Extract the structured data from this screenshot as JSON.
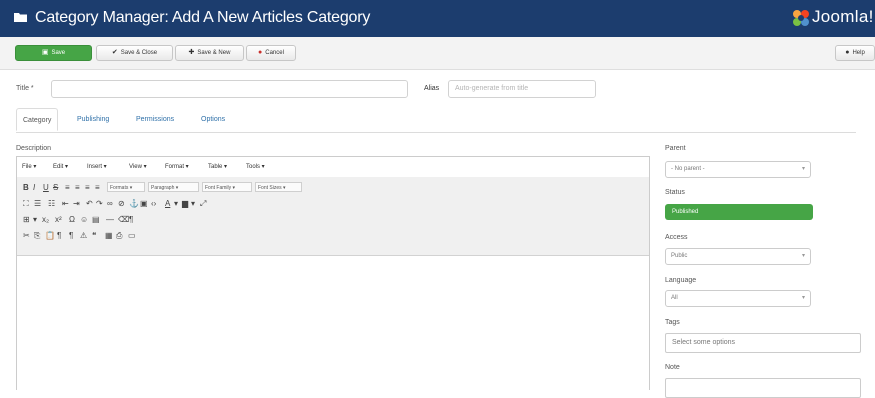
{
  "header": {
    "title": "Category Manager: Add A New Articles Category",
    "logo_text": "Joomla!"
  },
  "toolbar": {
    "save_label": "Save",
    "save_close_label": "Save & Close",
    "save_new_label": "Save & New",
    "cancel_label": "Cancel",
    "help_label": "Help"
  },
  "form": {
    "title_label": "Title *",
    "title_value": "",
    "alias_label": "Alias",
    "alias_placeholder": "Auto-generate from title"
  },
  "tabs": [
    {
      "label": "Category"
    },
    {
      "label": "Publishing"
    },
    {
      "label": "Permissions"
    },
    {
      "label": "Options"
    }
  ],
  "editor": {
    "description_label": "Description",
    "menu": [
      "File",
      "Edit",
      "Insert",
      "View",
      "Format",
      "Table",
      "Tools"
    ],
    "formats_select": "Formats",
    "paragraph_select": "Paragraph",
    "font_family_select": "Font Family",
    "font_size_select": "Font Sizes"
  },
  "sidebar": {
    "parent_label": "Parent",
    "parent_value": "- No parent -",
    "status_label": "Status",
    "status_value": "Published",
    "access_label": "Access",
    "access_value": "Public",
    "language_label": "Language",
    "language_value": "All",
    "tags_label": "Tags",
    "tags_placeholder": "Select some options",
    "note_label": "Note"
  },
  "colors": {
    "header_bg": "#1c3d6e",
    "save_green": "#46a546",
    "link_blue": "#3071a9"
  }
}
